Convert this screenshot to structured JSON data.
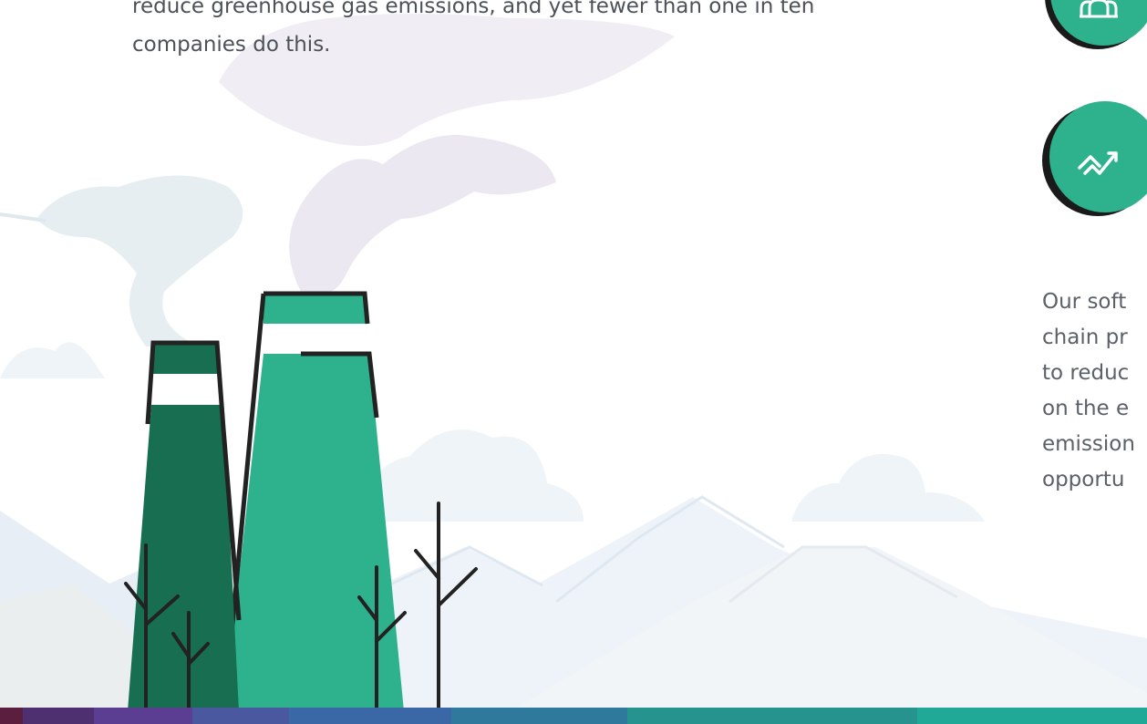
{
  "intro": {
    "line1": "reduce greenhouse gas emissions, and yet fewer than one in ten",
    "line2": "companies do this."
  },
  "side_text": {
    "lines": [
      "Our soft",
      "chain pr",
      "to reduc",
      "on the e",
      "emission",
      "opportu"
    ]
  },
  "icons": {
    "top": "people-group-icon",
    "middle": "trend-up-icon"
  },
  "colors": {
    "brand_green": "#2db28d",
    "dark_green": "#176e51",
    "outline": "#222222",
    "cloud": "#e8eef2",
    "mountain": "#eef3f7"
  },
  "bottom_bar": {
    "segments": [
      "#5c1e3e",
      "#4e2f6f",
      "#5b3d91",
      "#4a58a0",
      "#3a67a5",
      "#2f7a9c",
      "#26938f",
      "#20a997"
    ]
  }
}
